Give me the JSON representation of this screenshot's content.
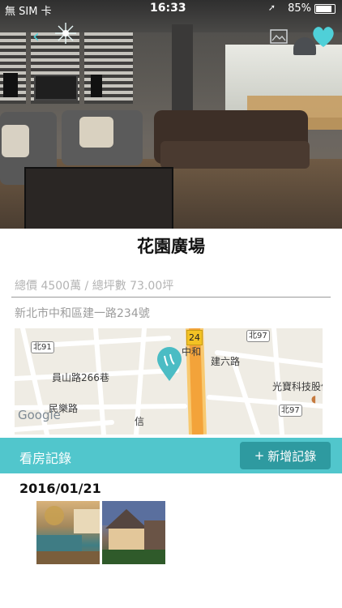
{
  "status_bar": {
    "carrier": "無 SIM 卡",
    "time": "16:33",
    "battery": "85%",
    "battery_level": 0.85
  },
  "hero": {
    "back_icon": "back-arrow-icon",
    "photos_icon": "photos-icon",
    "favorite_icon": "heart-icon",
    "favorite_color": "#4fd0d8"
  },
  "listing": {
    "title": "花園廣場",
    "price_area": "總價 4500萬 / 總坪數 73.00坪",
    "address": "新北市中和區建一路234號"
  },
  "map": {
    "labels": [
      "中和",
      "建六路",
      "員山路266巷",
      "民樂路",
      "光寶科技股份",
      "信"
    ],
    "road_badges": [
      "北91",
      "北97",
      "北97"
    ],
    "route_number": "24",
    "watermark": "Google",
    "marker_icon": "map-pin-icon"
  },
  "records": {
    "title": "看房記錄",
    "add_button": "新增記錄",
    "add_symbol": "+",
    "entries": [
      {
        "date": "2016/01/21"
      }
    ]
  },
  "colors": {
    "accent": "#51c6cc",
    "accent_dark": "#2e9aa0"
  }
}
